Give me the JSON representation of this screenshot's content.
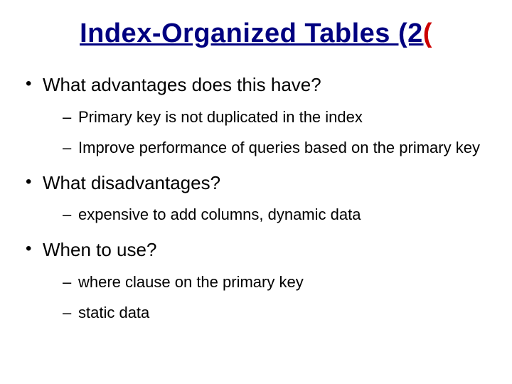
{
  "title": {
    "main": "Index-Organized Tables (2",
    "trailing_paren": "("
  },
  "bullets": [
    {
      "text": "What advantages does this have?",
      "children": [
        "Primary key is not duplicated in the index",
        "Improve performance of queries based on the primary key"
      ]
    },
    {
      "text": "What disadvantages?",
      "children": [
        "expensive to add columns, dynamic data"
      ]
    },
    {
      "text": "When to use?",
      "children": [
        "where clause on the primary key",
        "static data"
      ]
    }
  ]
}
